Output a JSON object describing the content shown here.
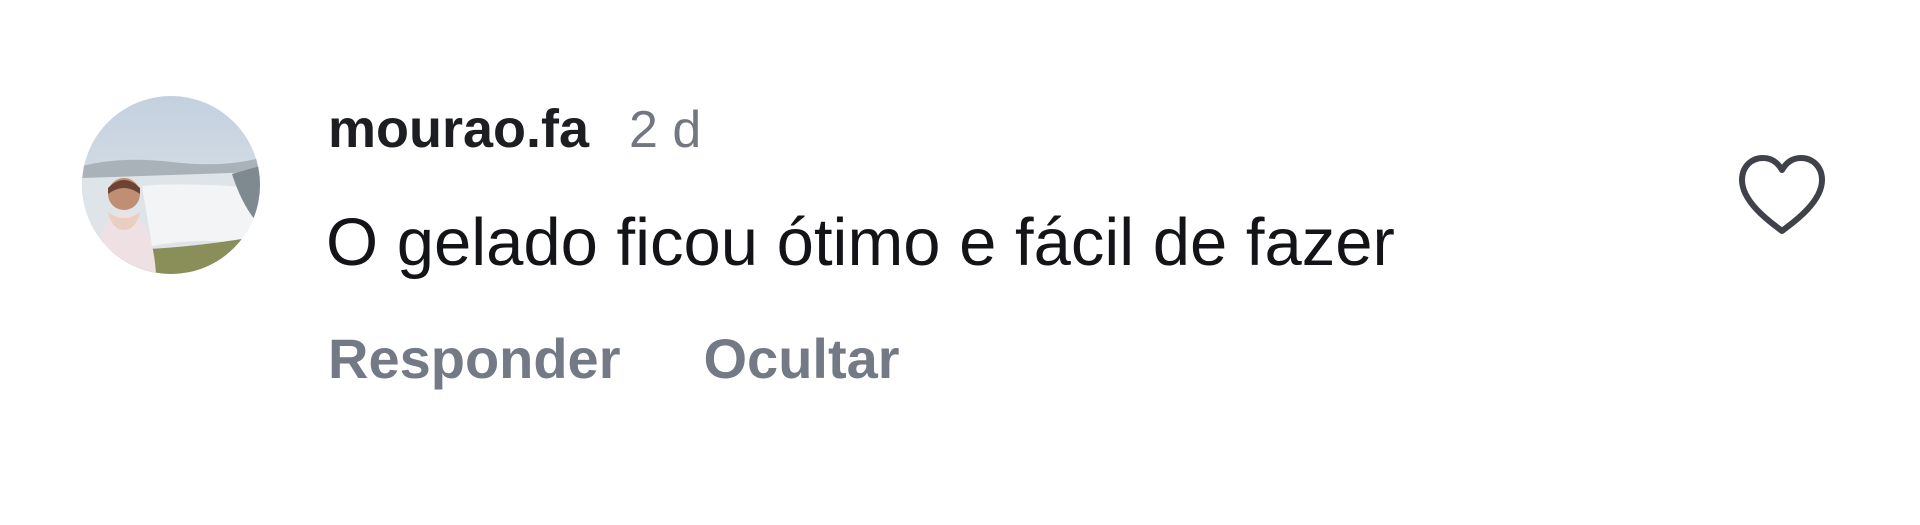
{
  "comment": {
    "username": "mourao.fa",
    "time_ago": "2 d",
    "text": "O gelado ficou ótimo e fácil de fazer",
    "actions": {
      "reply_label": "Responder",
      "hide_label": "Ocultar"
    },
    "like_icon": "heart-outline-icon"
  },
  "colors": {
    "text": "#121417",
    "secondary": "#737a85",
    "background": "#ffffff"
  }
}
